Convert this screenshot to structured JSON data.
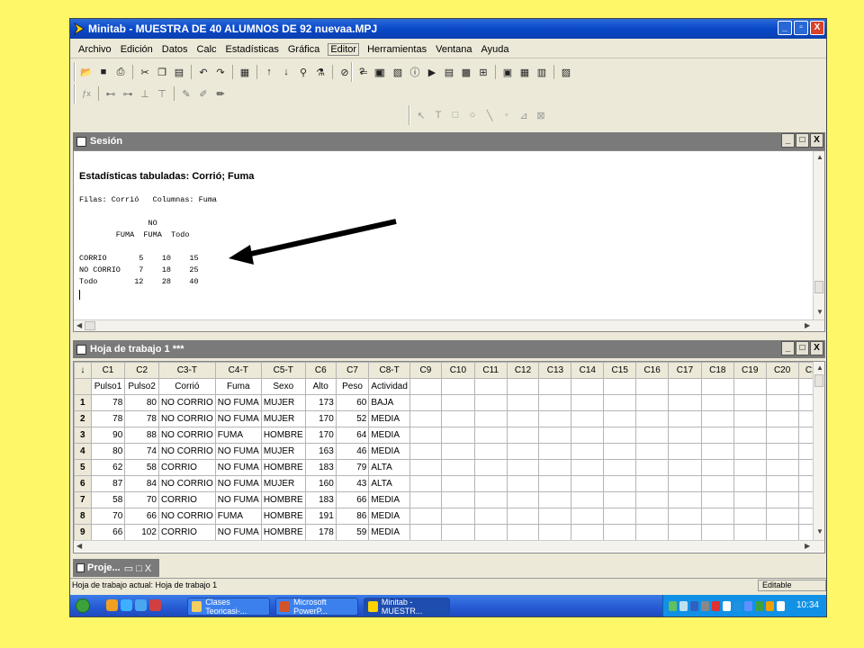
{
  "window": {
    "title": "Minitab - MUESTRA DE 40 ALUMNOS DE 92 nuevaa.MPJ",
    "min": "_",
    "max": "▫",
    "close": "X"
  },
  "menu": [
    "Archivo",
    "Edición",
    "Datos",
    "Calc",
    "Estadísticas",
    "Gráfica",
    "Editor",
    "Herramientas",
    "Ventana",
    "Ayuda"
  ],
  "session": {
    "title": "Sesión",
    "heading": "Estadísticas tabuladas: Corrió; Fuma",
    "filas_line": "Filas: Corrió   Columnas: Fuma",
    "table_hdr1": "               NO",
    "table_hdr2": "        FUMA  FUMA  Todo",
    "row1": "CORRIO       5    10    15",
    "row2": "NO CORRIO    7    18    25",
    "row3": "Todo        12    28    40"
  },
  "worksheet": {
    "title": "Hoja de trabajo 1 ***",
    "arrow_header": "↓",
    "col_ids": [
      "C1",
      "C2",
      "C3-T",
      "C4-T",
      "C5-T",
      "C6",
      "C7",
      "C8-T",
      "C9",
      "C10",
      "C11",
      "C12",
      "C13",
      "C14",
      "C15",
      "C16",
      "C17",
      "C18",
      "C19",
      "C20",
      "C2"
    ],
    "col_names": [
      "Pulso1",
      "Pulso2",
      "Corrió",
      "Fuma",
      "Sexo",
      "Alto",
      "Peso",
      "Actividad",
      "",
      "",
      "",
      "",
      "",
      "",
      "",
      "",
      "",
      "",
      "",
      "",
      ""
    ],
    "rows": [
      {
        "n": "1",
        "c": [
          "78",
          "80",
          "NO CORRIO",
          "NO FUMA",
          "MUJER",
          "173",
          "60",
          "BAJA"
        ]
      },
      {
        "n": "2",
        "c": [
          "78",
          "78",
          "NO CORRIO",
          "NO FUMA",
          "MUJER",
          "170",
          "52",
          "MEDIA"
        ]
      },
      {
        "n": "3",
        "c": [
          "90",
          "88",
          "NO CORRIO",
          "FUMA",
          "HOMBRE",
          "170",
          "64",
          "MEDIA"
        ]
      },
      {
        "n": "4",
        "c": [
          "80",
          "74",
          "NO CORRIO",
          "NO FUMA",
          "MUJER",
          "163",
          "46",
          "MEDIA"
        ]
      },
      {
        "n": "5",
        "c": [
          "62",
          "58",
          "CORRIO",
          "NO FUMA",
          "HOMBRE",
          "183",
          "79",
          "ALTA"
        ]
      },
      {
        "n": "6",
        "c": [
          "87",
          "84",
          "NO CORRIO",
          "NO FUMA",
          "MUJER",
          "160",
          "43",
          "ALTA"
        ]
      },
      {
        "n": "7",
        "c": [
          "58",
          "70",
          "CORRIO",
          "NO FUMA",
          "HOMBRE",
          "183",
          "66",
          "MEDIA"
        ]
      },
      {
        "n": "8",
        "c": [
          "70",
          "66",
          "NO CORRIO",
          "FUMA",
          "HOMBRE",
          "191",
          "86",
          "MEDIA"
        ]
      },
      {
        "n": "9",
        "c": [
          "66",
          "102",
          "CORRIO",
          "NO FUMA",
          "HOMBRE",
          "178",
          "59",
          "MEDIA"
        ]
      }
    ]
  },
  "project": {
    "title": "Proje..."
  },
  "status": {
    "left": "Hoja de trabajo actual: Hoja de trabajo 1",
    "right": "Editable"
  },
  "taskbar": {
    "tasks": [
      "Clases Teoricasi-...",
      "Microsoft PowerP...",
      "Minitab - MUESTR..."
    ],
    "clock": "10:34"
  },
  "colors": {
    "background": "#fef868",
    "titlebar": "#0a48c8",
    "arrow": "#000000"
  }
}
